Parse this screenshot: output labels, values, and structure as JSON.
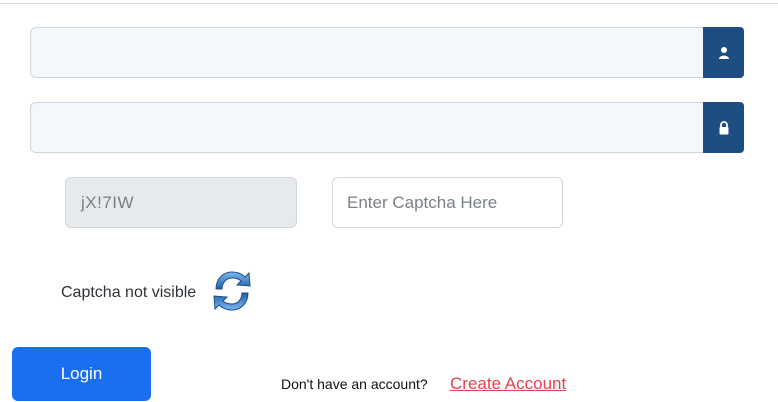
{
  "form": {
    "username": {
      "value": "",
      "placeholder": "",
      "icon": "user-icon"
    },
    "password": {
      "value": "",
      "placeholder": "",
      "icon": "lock-icon"
    },
    "captcha": {
      "code": "jX!7IW",
      "input_placeholder": "Enter Captcha Here",
      "input_value": "",
      "not_visible_text": "Captcha not visible",
      "refresh_icon": "refresh-icon"
    },
    "login_label": "Login",
    "account_prompt": "Don't have an account?",
    "create_account_label": "Create Account"
  },
  "colors": {
    "addon": "#1d4d82",
    "login_button": "#1a6ff0",
    "create_link": "#e0444b",
    "refresh_blue": "#2f7cc7"
  }
}
